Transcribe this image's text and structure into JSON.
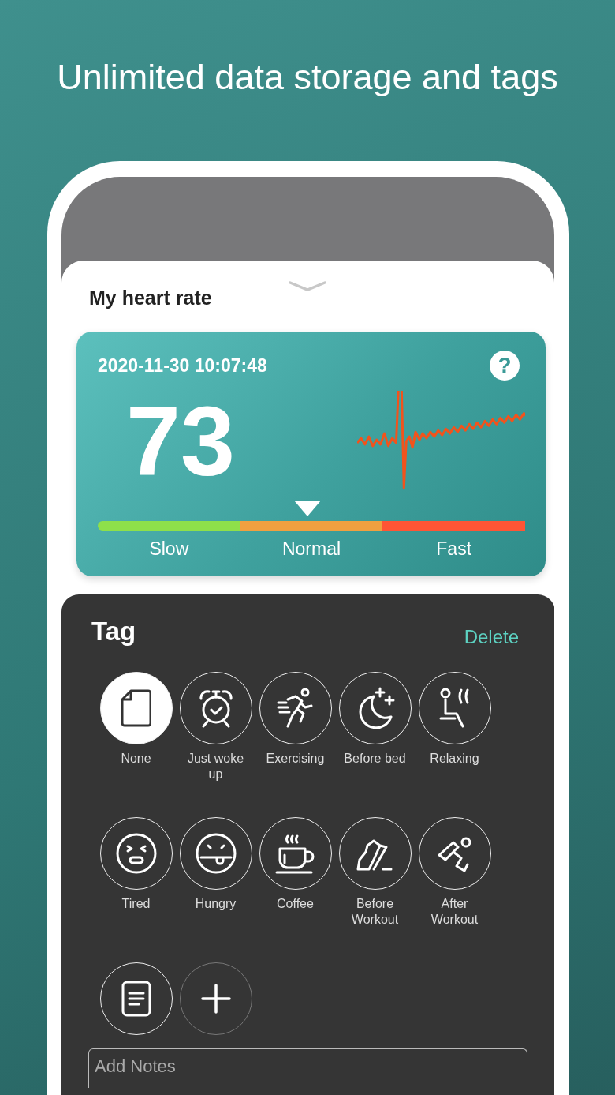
{
  "headline": "Unlimited data storage and tags",
  "screen": {
    "title": "My heart rate",
    "reading": {
      "timestamp": "2020-11-30 10:07:48",
      "help": "?",
      "bpm": "73",
      "level": 0.49,
      "zones": [
        {
          "label": "Slow",
          "color": "#8ee04a"
        },
        {
          "label": "Normal",
          "color": "#f0a040"
        },
        {
          "label": "Fast",
          "color": "#ff5535"
        }
      ]
    },
    "tags": {
      "title": "Tag",
      "action": "Delete",
      "items": [
        {
          "kind": "none",
          "label": "None",
          "selected": true
        },
        {
          "kind": "alarm",
          "label": "Just woke up",
          "selected": false
        },
        {
          "kind": "runner",
          "label": "Exercising",
          "selected": false
        },
        {
          "kind": "moon",
          "label": "Before bed",
          "selected": false
        },
        {
          "kind": "seat",
          "label": "Relaxing",
          "selected": false
        },
        {
          "kind": "tired",
          "label": "Tired",
          "selected": false
        },
        {
          "kind": "hungry",
          "label": "Hungry",
          "selected": false
        },
        {
          "kind": "coffee",
          "label": "Coffee",
          "selected": false
        },
        {
          "kind": "shoe",
          "label": "Before Workout",
          "selected": false
        },
        {
          "kind": "athlete",
          "label": "After Workout",
          "selected": false
        },
        {
          "kind": "note",
          "selected": false
        },
        {
          "kind": "add",
          "selected": false
        }
      ]
    },
    "notes": {
      "placeholder": "Add Notes"
    }
  }
}
